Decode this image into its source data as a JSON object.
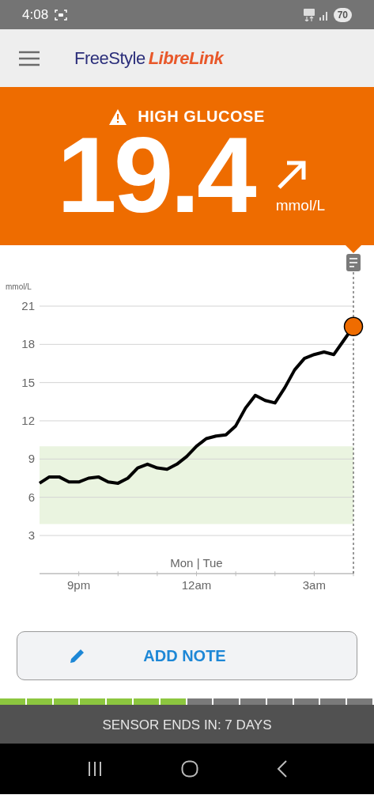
{
  "status_bar": {
    "time": "4:08",
    "battery": "70"
  },
  "header": {
    "brand_first": "FreeStyle",
    "brand_second": "LibreLink"
  },
  "alert": {
    "label": "HIGH GLUCOSE",
    "reading": "19.4",
    "unit": "mmol/L"
  },
  "chart": {
    "chart_data": {
      "type": "line",
      "ylabel": "mmol/L",
      "categories": [
        null,
        null,
        null,
        null,
        "9pm",
        null,
        null,
        null,
        null,
        null,
        null,
        null,
        null,
        null,
        null,
        null,
        "12am",
        null,
        null,
        null,
        null,
        null,
        null,
        null,
        null,
        null,
        null,
        null,
        "3am",
        null,
        null,
        null,
        null
      ],
      "series": [
        {
          "color": "#000000",
          "values": [
            7.1,
            7.6,
            7.6,
            7.2,
            7.2,
            7.5,
            7.6,
            7.2,
            7.1,
            7.5,
            8.3,
            8.6,
            8.3,
            8.2,
            8.6,
            9.2,
            10.0,
            10.6,
            10.8,
            10.9,
            11.6,
            13.0,
            14.0,
            13.6,
            13.4,
            14.6,
            16.0,
            16.9,
            17.2,
            17.4,
            17.2,
            18.3,
            19.4
          ]
        }
      ],
      "ylim": [
        0,
        21
      ],
      "grid": true,
      "yticks": [
        3,
        6,
        9,
        12,
        15,
        18,
        21
      ],
      "bands": [
        {
          "axis": "y",
          "from": 3.9,
          "to": 10
        }
      ],
      "annotations": [
        "Mon | Tue"
      ]
    }
  },
  "add_note": {
    "label": "ADD NOTE"
  },
  "sensor": {
    "level": 0.5,
    "text": "SENSOR ENDS IN: 7 DAYS"
  }
}
